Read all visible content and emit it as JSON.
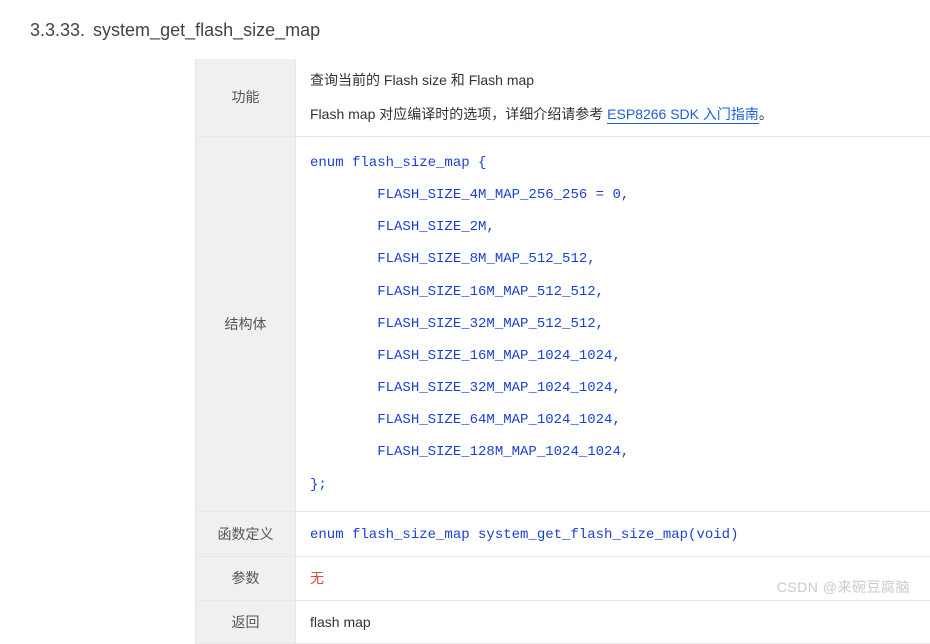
{
  "heading": {
    "number": "3.3.33.",
    "title": "system_get_flash_size_map"
  },
  "rows": {
    "function": {
      "label": "功能",
      "line1": "查询当前的 Flash size 和 Flash map",
      "line2_pre": "Flash map 对应编译时的选项，详细介绍请参考 ",
      "link": "ESP8266 SDK 入门指南",
      "line2_post": "。"
    },
    "struct": {
      "label": "结构体",
      "code": "enum flash_size_map {\n        FLASH_SIZE_4M_MAP_256_256 = 0,\n        FLASH_SIZE_2M,\n        FLASH_SIZE_8M_MAP_512_512,\n        FLASH_SIZE_16M_MAP_512_512,\n        FLASH_SIZE_32M_MAP_512_512,\n        FLASH_SIZE_16M_MAP_1024_1024,\n        FLASH_SIZE_32M_MAP_1024_1024,\n        FLASH_SIZE_64M_MAP_1024_1024,\n        FLASH_SIZE_128M_MAP_1024_1024,\n};"
    },
    "definition": {
      "label": "函数定义",
      "code": "enum flash_size_map system_get_flash_size_map(void)"
    },
    "params": {
      "label": "参数",
      "value": "无"
    },
    "ret": {
      "label": "返回",
      "value": "flash map"
    }
  },
  "watermark": "CSDN @来碗豆腐脑"
}
